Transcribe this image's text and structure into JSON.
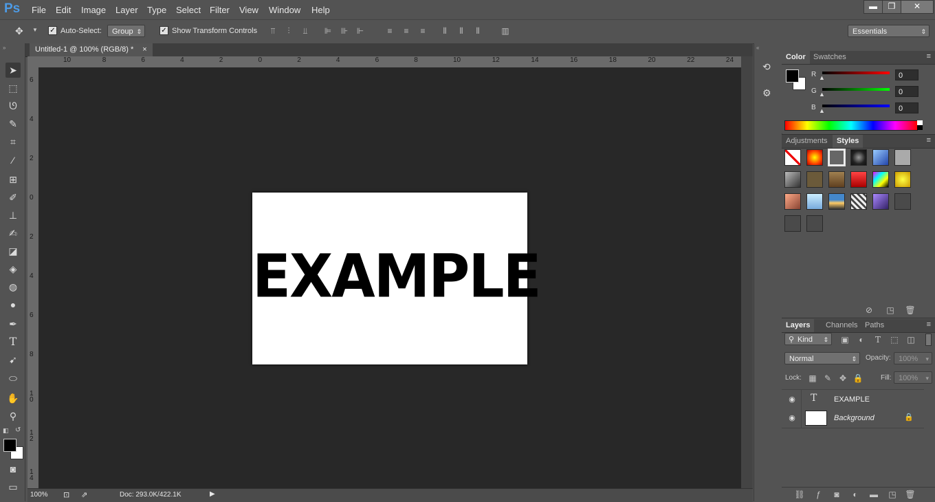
{
  "app": {
    "logo": "Ps"
  },
  "menu": [
    "File",
    "Edit",
    "Image",
    "Layer",
    "Type",
    "Select",
    "Filter",
    "View",
    "Window",
    "Help"
  ],
  "window_controls": {
    "minimize": "▬",
    "restore": "❐",
    "close": "✕"
  },
  "options": {
    "auto_select_label": "Auto-Select:",
    "auto_select_checked": true,
    "auto_select_value": "Group",
    "transform_label": "Show Transform Controls",
    "transform_checked": true,
    "workspace": "Essentials"
  },
  "document": {
    "tab_title": "Untitled-1 @ 100% (RGB/8) *",
    "tab_close": "×",
    "canvas_text": "EXAMPLE",
    "h_ruler": [
      "10",
      "8",
      "6",
      "4",
      "2",
      "0",
      "2",
      "4",
      "6",
      "8",
      "10",
      "12",
      "14",
      "16",
      "18",
      "20",
      "22",
      "24"
    ],
    "v_ruler": [
      "6",
      "4",
      "2",
      "0",
      "2",
      "4",
      "6",
      "8",
      "1\n0",
      "1\n2",
      "1\n4"
    ],
    "canvas_color": "#ffffff",
    "pasteboard_color": "#282828"
  },
  "status": {
    "zoom": "100%",
    "doc": "Doc: 293.0K/422.1K"
  },
  "color_panel": {
    "tabs": [
      "Color",
      "Swatches"
    ],
    "active_tab": "Color",
    "channels": [
      {
        "label": "R",
        "value": "0",
        "color": "#e02020"
      },
      {
        "label": "G",
        "value": "0",
        "color": "#20c020"
      },
      {
        "label": "B",
        "value": "0",
        "color": "#2040e0"
      }
    ]
  },
  "styles_panel": {
    "tabs": [
      "Adjustments",
      "Styles"
    ],
    "active_tab": "Styles"
  },
  "layers_panel": {
    "tabs": [
      "Layers",
      "Channels",
      "Paths"
    ],
    "active_tab": "Layers",
    "filter_kind": "Kind",
    "blend_mode": "Normal",
    "opacity_label": "Opacity:",
    "opacity_value": "100%",
    "lock_label": "Lock:",
    "fill_label": "Fill:",
    "fill_value": "100%",
    "layers": [
      {
        "name": "EXAMPLE",
        "type": "text",
        "visible": true
      },
      {
        "name": "Background",
        "type": "pixel",
        "visible": true,
        "locked": true
      }
    ]
  }
}
